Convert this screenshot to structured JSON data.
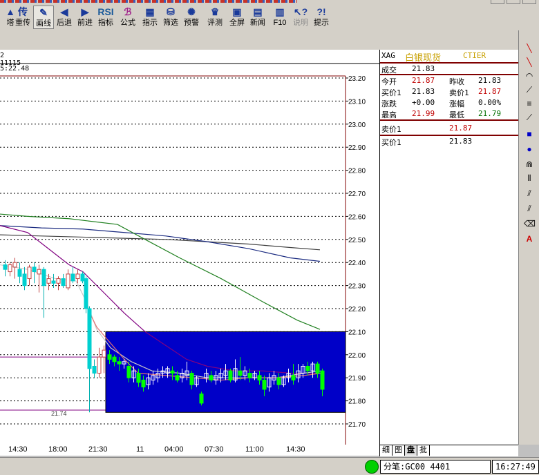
{
  "toolbar": {
    "items": [
      {
        "label": "塔",
        "icon": "pagoda-icon",
        "glyph": "▲"
      },
      {
        "label": "重传",
        "icon": "retransmit-icon",
        "glyph": "传"
      },
      {
        "label": "画线",
        "icon": "draw-line-icon",
        "glyph": "✎"
      },
      {
        "label": "后退",
        "icon": "back-icon",
        "glyph": "◀"
      },
      {
        "label": "前进",
        "icon": "forward-icon",
        "glyph": "▶"
      },
      {
        "label": "指标",
        "icon": "indicator-icon",
        "glyph": "RSI"
      },
      {
        "label": "公式",
        "icon": "formula-icon",
        "glyph": "ℬ"
      },
      {
        "label": "指示",
        "icon": "indicate-icon",
        "glyph": "▦"
      },
      {
        "label": "筛选",
        "icon": "filter-icon",
        "glyph": "⛁"
      },
      {
        "label": "预警",
        "icon": "alert-icon",
        "glyph": "✺"
      },
      {
        "label": "评测",
        "icon": "evaluate-icon",
        "glyph": "♛"
      },
      {
        "label": "全屏",
        "icon": "fullscreen-icon",
        "glyph": "▣"
      },
      {
        "label": "新闻",
        "icon": "news-icon",
        "glyph": "▤"
      },
      {
        "label": "F10",
        "icon": "f10-icon",
        "glyph": "▥"
      },
      {
        "label": "说明",
        "icon": "help-pointer-icon",
        "glyph": "↖?"
      },
      {
        "label": "提示",
        "icon": "hint-icon",
        "glyph": "?!"
      }
    ]
  },
  "chart_info": {
    "line1": "2 11115",
    "line2": "5:22.48"
  },
  "y_axis": {
    "ticks": [
      "23.20",
      "23.10",
      "23.00",
      "22.90",
      "22.80",
      "22.70",
      "22.60",
      "22.50",
      "22.40",
      "22.30",
      "22.20",
      "22.10",
      "22.00",
      "21.90",
      "21.80",
      "21.70"
    ]
  },
  "time_axis": {
    "ticks": [
      "14:30",
      "18:00",
      "21:30",
      "11",
      "04:00",
      "07:30",
      "11:00",
      "14:30"
    ]
  },
  "low_marker": "21.74",
  "quote": {
    "symbol": "XAG",
    "name": "白银现货",
    "code": "CTIER",
    "rows": [
      {
        "l1": "成交",
        "v1": "21.83",
        "c1": "blk"
      },
      {
        "l1": "今开",
        "v1": "21.87",
        "c1": "red",
        "l2": "昨收",
        "v2": "21.83",
        "c2": "blk"
      },
      {
        "l1": "买价1",
        "v1": "21.83",
        "c1": "blk",
        "l2": "卖价1",
        "v2": "21.87",
        "c2": "red"
      },
      {
        "l1": "涨跌",
        "v1": "+0.00",
        "c1": "blk",
        "l2": "涨幅",
        "v2": "0.00%",
        "c2": "blk"
      },
      {
        "l1": "最高",
        "v1": "21.99",
        "c1": "red",
        "l2": "最低",
        "v2": "21.79",
        "c2": "green"
      }
    ],
    "ask_label": "卖价1",
    "ask_value": "21.87",
    "bid_label": "买价1",
    "bid_value": "21.83"
  },
  "bottom_tabs": [
    "细",
    "图",
    "盘",
    "批"
  ],
  "status": {
    "account": "分笔:GC00  4401",
    "time": "16:27:49"
  },
  "colors": {
    "selection_box": "#0000c8",
    "ma_green": "#208020",
    "ma_navy": "#1a2a80",
    "ma_gray": "#404040",
    "ma_purple": "#800080",
    "up_candle": "#e0e0e0",
    "down_candle": "#00e0e0"
  }
}
